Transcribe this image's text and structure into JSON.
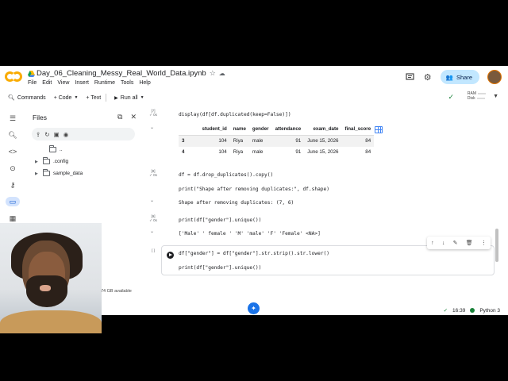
{
  "header": {
    "notebook_title": "Day_06_Cleaning_Messy_Real_World_Data.ipynb",
    "menu": [
      "File",
      "Edit",
      "View",
      "Insert",
      "Runtime",
      "Tools",
      "Help"
    ],
    "share_label": "Share"
  },
  "toolbar": {
    "commands_label": "Commands",
    "code_label": "+ Code",
    "text_label": "+ Text",
    "run_all_label": "Run all",
    "ram_label": "RAM",
    "disk_label": "Disk"
  },
  "files_panel": {
    "title": "Files",
    "items": [
      {
        "name": ".."
      },
      {
        "name": ".config"
      },
      {
        "name": "sample_data"
      }
    ],
    "disk_text": "74 GB available"
  },
  "cells": {
    "c1": {
      "exec": "[7]",
      "time": "0s",
      "code": "display(df[df.duplicated(keep=False)])",
      "table": {
        "columns": [
          "",
          "student_id",
          "name",
          "gender",
          "attendance",
          "exam_date",
          "final_score"
        ],
        "rows": [
          [
            "3",
            "104",
            "Riya",
            "male",
            "91",
            "June 15, 2026",
            "84"
          ],
          [
            "4",
            "104",
            "Riya",
            "male",
            "91",
            "June 15, 2026",
            "84"
          ]
        ]
      }
    },
    "c2": {
      "exec": "[8]",
      "time": "0s",
      "line1": "df = df.drop_duplicates().copy()",
      "line2": "print(\"Shape after removing duplicates:\", df.shape)",
      "output": "Shape after removing duplicates: (7, 6)"
    },
    "c3": {
      "exec": "[9]",
      "time": "0s",
      "code": "print(df[\"gender\"].unique())",
      "output": "['Male' ' female ' 'M' 'male' 'F' 'Female' <NA>]"
    },
    "c4": {
      "exec": "[ ]",
      "line1": "df[\"gender\"] = df[\"gender\"].str.strip().str.lower()",
      "line2": "print(df[\"gender\"].unique())"
    }
  },
  "status": {
    "time": "16:39",
    "runtime": "Python 3"
  },
  "colors": {
    "accent": "#1a73e8",
    "share_bg": "#c2e7ff",
    "ok_green": "#188038"
  }
}
